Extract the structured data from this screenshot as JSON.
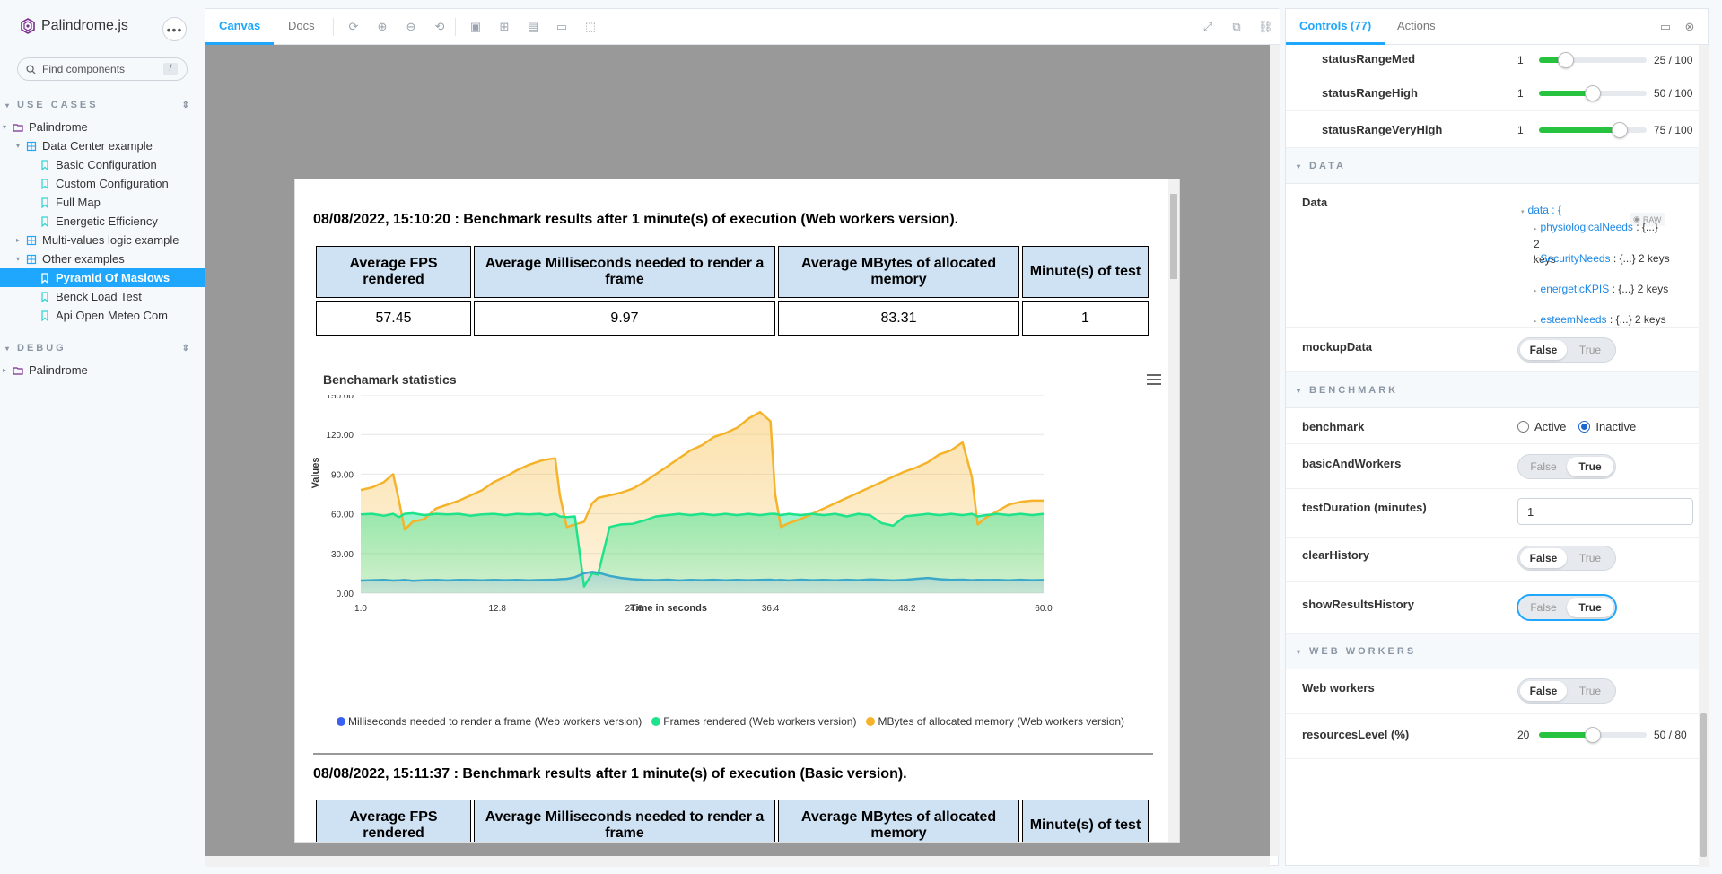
{
  "sidebar": {
    "brand": "Palindrome.js",
    "search_placeholder": "Find components",
    "search_shortcut": "/",
    "sections": [
      {
        "title": "USE CASES"
      },
      {
        "title": "DEBUG"
      }
    ],
    "items": [
      {
        "label": "Palindrome"
      },
      {
        "label": "Data Center example"
      },
      {
        "label": "Basic Configuration"
      },
      {
        "label": "Custom Configuration"
      },
      {
        "label": "Full Map"
      },
      {
        "label": "Energetic Efficiency"
      },
      {
        "label": "Multi-values logic example"
      },
      {
        "label": "Other examples"
      },
      {
        "label": "Pyramid Of Maslows"
      },
      {
        "label": "Benck Load Test"
      },
      {
        "label": "Api Open Meteo Com"
      },
      {
        "label": "Palindrome"
      }
    ]
  },
  "canvas": {
    "tabs": [
      {
        "label": "Canvas"
      },
      {
        "label": "Docs"
      }
    ],
    "results": [
      {
        "title": "08/08/2022, 15:10:20 : Benchmark results after 1 minute(s) of execution (Web workers version).",
        "headers": [
          "Average FPS rendered",
          "Average Milliseconds needed to render a frame",
          "Average MBytes of allocated memory",
          "Minute(s) of test"
        ],
        "values": [
          "57.45",
          "9.97",
          "83.31",
          "1"
        ]
      },
      {
        "title": "08/08/2022, 15:11:37 : Benchmark results after 1 minute(s) of execution (Basic version).",
        "headers": [
          "Average FPS rendered",
          "Average Milliseconds needed to render a frame",
          "Average MBytes of allocated memory",
          "Minute(s) of test"
        ]
      }
    ]
  },
  "chart_data": {
    "type": "area",
    "title": "Benchamark statistics",
    "xlabel": "Time in seconds",
    "ylabel": "Values",
    "xlim": [
      1.0,
      60.0
    ],
    "ylim": [
      0,
      150
    ],
    "x_ticks": [
      "1.0",
      "12.8",
      "24.6",
      "36.4",
      "48.2",
      "60.0"
    ],
    "y_ticks": [
      "150.00",
      "120.00",
      "90.00",
      "60.00",
      "30.00",
      "0.00"
    ],
    "grid": true,
    "legend_position": "bottom",
    "x": [
      1,
      2,
      3,
      3.8,
      4.3,
      4.8,
      5.5,
      6.5,
      7.5,
      8.5,
      9.5,
      10.5,
      11.5,
      12.5,
      13.5,
      14.5,
      15.5,
      16.5,
      17,
      17.8,
      18.2,
      18.8,
      19.5,
      20.3,
      21,
      21.5,
      22.5,
      23.5,
      24.5,
      25.5,
      26.5,
      27.5,
      28.5,
      29.5,
      30.5,
      31.5,
      32.5,
      33.5,
      34.5,
      35.5,
      36.4,
      36.8,
      37.3,
      38,
      39,
      40,
      41,
      42,
      43,
      44,
      45,
      46,
      47,
      48,
      49,
      50,
      51,
      52,
      53,
      53.8,
      54.3,
      55,
      56,
      57,
      58,
      59,
      60
    ],
    "series": [
      {
        "name": "Milliseconds needed to render a frame (Web workers version)",
        "color": "#3a62f0",
        "values": [
          9.5,
          9.8,
          10,
          9.5,
          9.7,
          10,
          9.4,
          9.8,
          10,
          9.6,
          10,
          9.9,
          9.7,
          10,
          9.8,
          10,
          9.7,
          9.9,
          10,
          10.2,
          10.5,
          10.8,
          12,
          15,
          16,
          15.5,
          13,
          11.5,
          10.5,
          10,
          9.8,
          10.2,
          9.6,
          10,
          9.8,
          10.1,
          9.7,
          10,
          9.8,
          10,
          10.2,
          9.8,
          10,
          9.6,
          10.2,
          9.8,
          10,
          9.7,
          10.1,
          9.8,
          10.3,
          10,
          9.6,
          10,
          10.8,
          11.5,
          10.5,
          10,
          10.2,
          9.8,
          10,
          9.9,
          10,
          9.7,
          10.1,
          9.8,
          9.9
        ]
      },
      {
        "name": "Frames rendered (Web workers version)",
        "color": "#1de38a",
        "values": [
          59.5,
          60,
          58.5,
          60,
          57.5,
          60,
          60.5,
          59,
          60,
          59.5,
          60,
          58.5,
          59.5,
          60,
          59,
          60,
          59.5,
          60,
          59,
          60,
          58,
          57.5,
          58,
          5,
          15,
          14,
          50,
          52,
          52.5,
          55,
          58,
          59,
          60,
          59,
          60,
          59,
          60,
          59,
          60,
          59,
          60,
          60,
          59,
          60,
          59,
          60,
          59,
          60,
          58,
          60,
          59,
          53,
          51,
          58,
          59,
          60,
          59,
          60,
          59,
          60,
          58,
          59,
          60,
          59,
          60,
          59,
          60
        ]
      },
      {
        "name": "MBytes of allocated memory (Web workers version)",
        "color": "#f5b32a",
        "values": [
          78,
          80,
          84,
          90,
          70,
          48,
          54,
          56,
          64,
          67,
          70,
          74,
          78,
          84,
          88,
          93,
          97,
          100,
          101,
          102,
          74,
          50,
          52,
          54,
          68,
          72,
          74,
          76,
          79,
          84,
          90,
          96,
          102,
          108,
          112,
          118,
          121,
          125,
          132,
          137,
          130,
          75,
          50,
          53,
          56,
          60,
          64,
          68,
          72,
          76,
          80,
          84,
          88,
          92,
          95,
          99,
          105,
          108,
          114,
          88,
          52,
          57,
          62,
          67,
          69,
          70,
          70
        ]
      }
    ]
  },
  "controls": {
    "tabs": [
      {
        "label": "Controls (77)"
      },
      {
        "label": "Actions"
      }
    ],
    "sliders": [
      {
        "label": "statusRangeMed",
        "min": "1",
        "value_text": "25 / 100",
        "fraction": 0.25
      },
      {
        "label": "statusRangeHigh",
        "min": "1",
        "value_text": "50 / 100",
        "fraction": 0.5
      },
      {
        "label": "statusRangeVeryHigh",
        "min": "1",
        "value_text": "75 / 100",
        "fraction": 0.75
      }
    ],
    "sections": {
      "data": "DATA",
      "benchmark": "BENCHMARK",
      "web_workers": "WEB WORKERS"
    },
    "data": {
      "label": "Data",
      "raw": "RAW",
      "root": "data : {",
      "entries": [
        {
          "key": "physiologicalNeeds",
          "summary": " : {...} 2"
        },
        {
          "key": "SecurityNeeds",
          "summary": " : {...} 2 keys"
        },
        {
          "key": "energeticKPIS",
          "summary": " : {...} 2 keys"
        },
        {
          "key": "esteemNeeds",
          "summary": " : {...} 2 keys"
        }
      ],
      "wrap": "keys",
      "close": "}"
    },
    "mockupData": {
      "label": "mockupData",
      "false": "False",
      "true": "True",
      "value": false
    },
    "benchmark": {
      "label": "benchmark",
      "active": "Active",
      "inactive": "Inactive",
      "value": "Inactive"
    },
    "basicAndWorkers": {
      "label": "basicAndWorkers",
      "false": "False",
      "true": "True",
      "value": true
    },
    "testDuration": {
      "label": "testDuration (minutes)",
      "value": "1"
    },
    "clearHistory": {
      "label": "clearHistory",
      "false": "False",
      "true": "True",
      "value": false
    },
    "showResultsHistory": {
      "label": "showResultsHistory",
      "false": "False",
      "true": "True",
      "value": true
    },
    "webWorkers": {
      "label": "Web workers",
      "false": "False",
      "true": "True",
      "value": false
    },
    "resourcesLevel": {
      "label": "resourcesLevel (%)",
      "min": "20",
      "value_text": "50 / 80",
      "fraction": 0.5
    }
  }
}
